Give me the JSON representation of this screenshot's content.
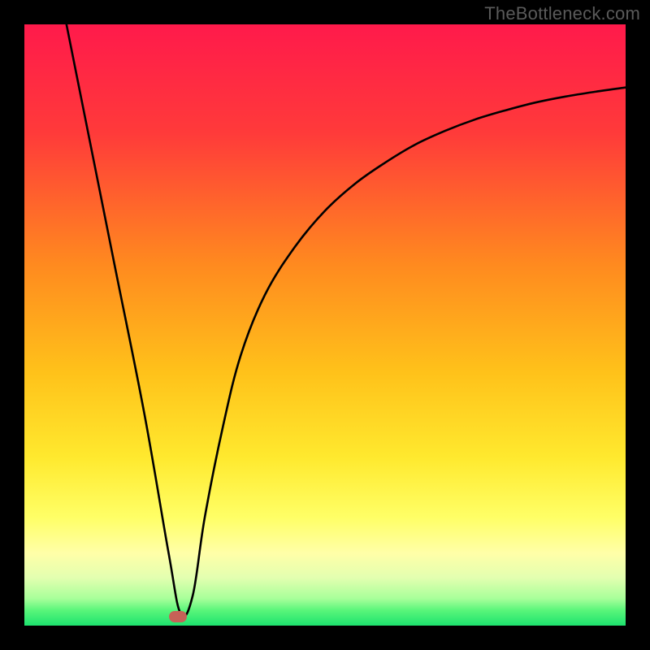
{
  "watermark": "TheBottleneck.com",
  "chart_data": {
    "type": "line",
    "title": "",
    "xlabel": "",
    "ylabel": "",
    "xlim": [
      0,
      100
    ],
    "ylim": [
      0,
      100
    ],
    "gradient_stops": [
      {
        "offset": 0,
        "color": "#ff1a4b"
      },
      {
        "offset": 18,
        "color": "#ff3a3a"
      },
      {
        "offset": 40,
        "color": "#ff8a1f"
      },
      {
        "offset": 58,
        "color": "#ffc21a"
      },
      {
        "offset": 72,
        "color": "#ffe92e"
      },
      {
        "offset": 82,
        "color": "#ffff66"
      },
      {
        "offset": 88,
        "color": "#ffffa8"
      },
      {
        "offset": 92,
        "color": "#e3ffb0"
      },
      {
        "offset": 95.5,
        "color": "#a8ff9a"
      },
      {
        "offset": 97.5,
        "color": "#58f57a"
      },
      {
        "offset": 100,
        "color": "#1de36e"
      }
    ],
    "series": [
      {
        "name": "bottleneck-curve",
        "x": [
          7,
          10,
          15,
          20,
          24,
          26,
          28,
          30,
          33,
          36,
          40,
          45,
          50,
          55,
          60,
          65,
          70,
          75,
          80,
          85,
          90,
          95,
          100
        ],
        "y": [
          100,
          85,
          60,
          35,
          12,
          2,
          5,
          18,
          33,
          45,
          55,
          63,
          69,
          73.5,
          77,
          80,
          82.3,
          84.2,
          85.7,
          87,
          88,
          88.8,
          89.5
        ]
      }
    ],
    "marker": {
      "x": 25.5,
      "y": 1.5,
      "color": "#c66257"
    }
  }
}
